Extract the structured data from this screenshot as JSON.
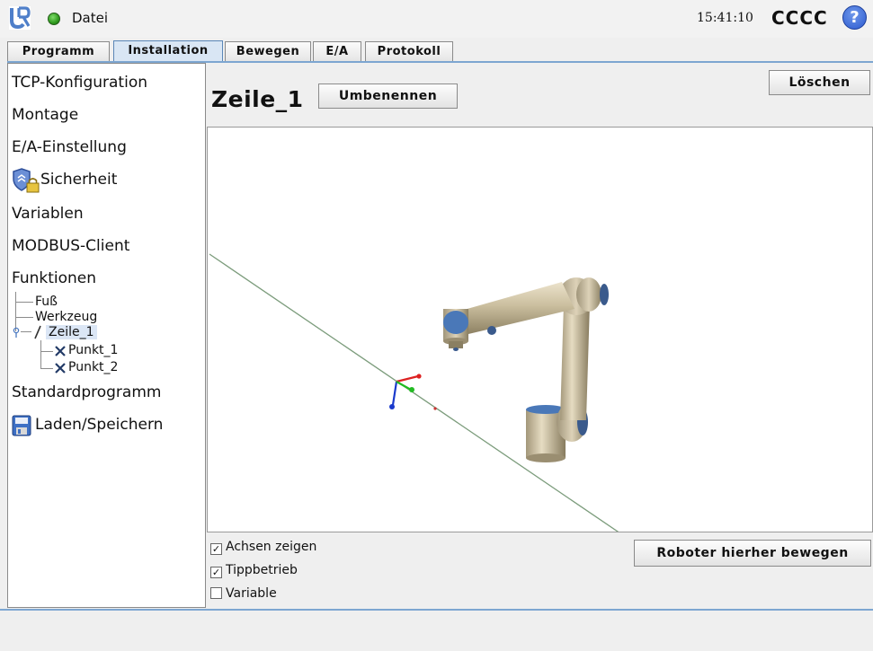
{
  "header": {
    "file_menu": "Datei",
    "time": "15:41:10",
    "robot_name": "CCCC",
    "help": "?"
  },
  "tabs": [
    {
      "label": "Programm"
    },
    {
      "label": "Installation",
      "active": true
    },
    {
      "label": "Bewegen"
    },
    {
      "label": "E/A"
    },
    {
      "label": "Protokoll"
    }
  ],
  "sidebar": {
    "items": [
      {
        "label": "TCP-Konfiguration"
      },
      {
        "label": "Montage"
      },
      {
        "label": "E/A-Einstellung"
      },
      {
        "label": "Sicherheit"
      },
      {
        "label": "Variablen"
      },
      {
        "label": "MODBUS-Client"
      },
      {
        "label": "Funktionen"
      }
    ],
    "tree": {
      "items": [
        "Fuß",
        "Werkzeug",
        "Zeile_1"
      ],
      "children": [
        "Punkt_1",
        "Punkt_2"
      ]
    },
    "bottom_items": [
      {
        "label": "Standardprogramm"
      },
      {
        "label": "Laden/Speichern"
      }
    ]
  },
  "main": {
    "title": "Zeile_1",
    "rename_button": "Umbenennen",
    "delete_button": "Löschen",
    "move_button": "Roboter hierher bewegen",
    "checkboxes": [
      {
        "label": "Achsen zeigen",
        "checked": true
      },
      {
        "label": "Tippbetrieb",
        "checked": true
      },
      {
        "label": "Variable",
        "checked": false
      }
    ]
  },
  "colors": {
    "accent": "#7da6d1",
    "status_ok": "#2f9a1e",
    "help": "#2c5ad0"
  }
}
